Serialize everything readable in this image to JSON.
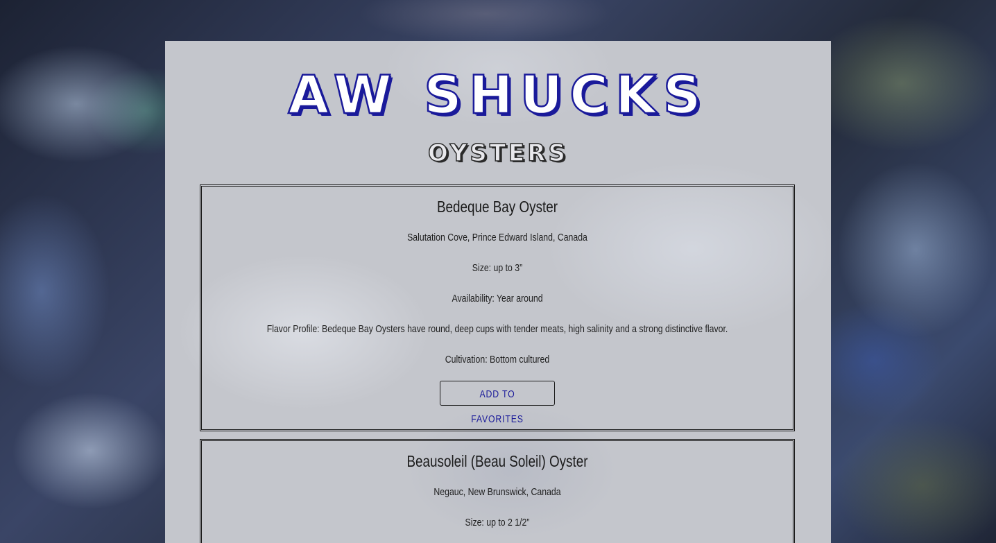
{
  "brand": {
    "title": "AW SHUCKS",
    "subtitle": "OYSTERS"
  },
  "oysters": [
    {
      "name": "Bedeque Bay Oyster",
      "location": "Salutation Cove, Prince Edward Island, Canada",
      "size": "Size: up to 3”",
      "availability": "Availability: Year around",
      "flavor": "Flavor Profile: Bedeque Bay Oysters have round, deep cups with tender meats, high salinity and a strong distinctive flavor.",
      "cultivation": "Cultivation: Bottom cultured",
      "button_label": "ADD TO FAVORITES"
    },
    {
      "name": "Beausoleil (Beau Soleil) Oyster",
      "location": "Negauc, New Brunswick, Canada",
      "size": "Size: up to 2 1/2”"
    }
  ],
  "colors": {
    "accent": "#1a1a9a",
    "panel": "#c4c6cc",
    "text": "#1e1e1e"
  }
}
